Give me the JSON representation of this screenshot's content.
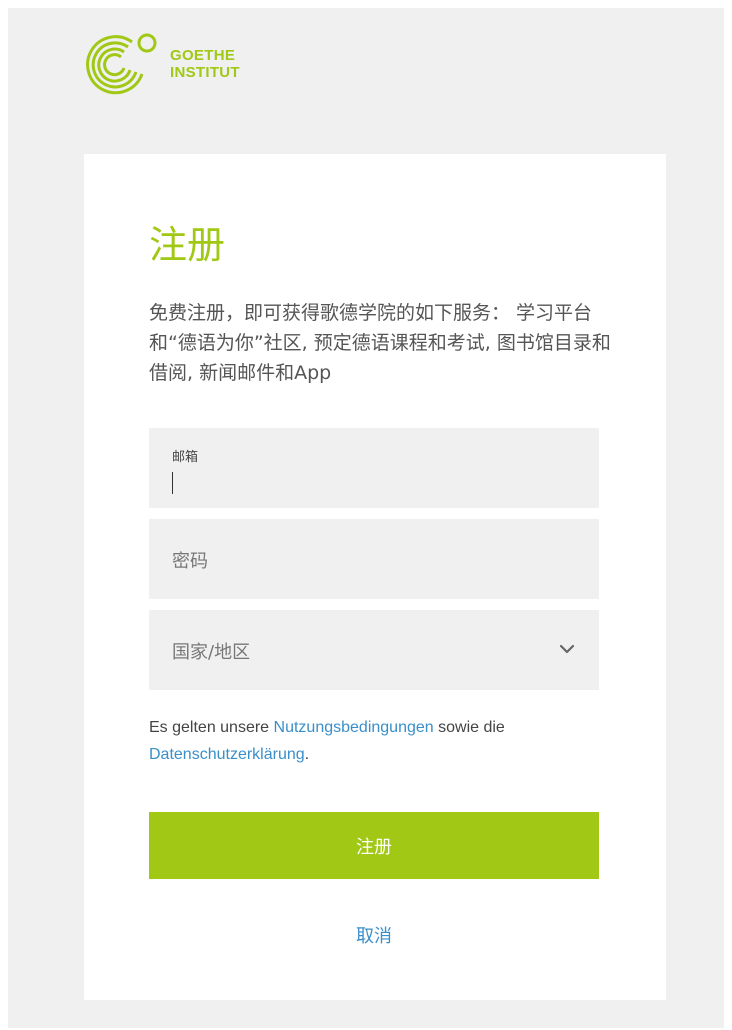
{
  "brand": {
    "logo_line1": "GOETHE",
    "logo_line2": "INSTITUT",
    "color": "#a0c814",
    "logo_icon": "goethe-rings-icon"
  },
  "form": {
    "title": "注册",
    "description": "免费注册，即可获得歌德学院的如下服务： 学习平台和“德语为你”社区, 预定德语课程和考试, 图书馆目录和借阅, 新闻邮件和App",
    "email_label": "邮箱",
    "email_value": "",
    "password_placeholder": "密码",
    "country_placeholder": "国家/地区",
    "country_icon": "chevron-down-icon",
    "terms_prefix": "Es gelten unsere ",
    "terms_link": "Nutzungsbedingungen",
    "terms_middle": " sowie die ",
    "privacy_link": "Datenschutzerklärung",
    "terms_suffix": ".",
    "submit_label": "注册",
    "cancel_label": "取消"
  },
  "colors": {
    "accent": "#a0c814",
    "link": "#3a8fc9",
    "field_bg": "#f0f0f0"
  }
}
